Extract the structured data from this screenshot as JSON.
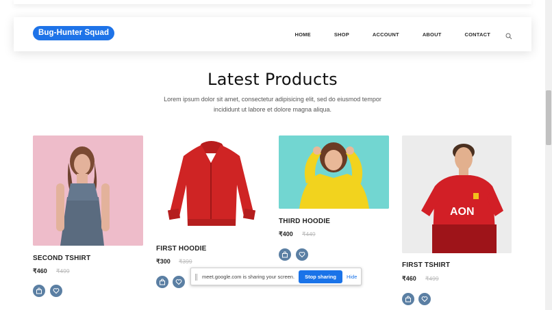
{
  "header": {
    "brand": "Bug-Hunter Squad",
    "nav": [
      "HOME",
      "SHOP",
      "ACCOUNT",
      "ABOUT",
      "CONTACT"
    ]
  },
  "section": {
    "title": "Latest Products",
    "description_line1": "Lorem ipsum dolor sit amet, consectetur adipisicing elit, sed do eiusmod tempor",
    "description_line2": "incididunt ut labore et dolore magna aliqua."
  },
  "products": [
    {
      "name": "SECOND TSHIRT",
      "price": "₹460",
      "old_price": "₹499",
      "image_icon": "woman-in-denim-dress"
    },
    {
      "name": "FIRST HOODIE",
      "price": "₹300",
      "old_price": "₹399",
      "image_icon": "red-hoodie"
    },
    {
      "name": "THIRD HOODIE",
      "price": "₹400",
      "old_price": "₹449",
      "image_icon": "woman-in-yellow-hoodie"
    },
    {
      "name": "FIRST TSHIRT",
      "price": "₹460",
      "old_price": "₹499",
      "image_icon": "man-in-red-jersey"
    }
  ],
  "product_icons": [
    "bag-icon",
    "heart-icon"
  ],
  "share_bar": {
    "message": "meet.google.com is sharing your screen.",
    "stop_label": "Stop sharing",
    "hide_label": "Hide"
  },
  "colors": {
    "brand_bg": "#1e73e8",
    "button_bg": "#5b7fa3",
    "stop_btn": "#1a73e8"
  }
}
